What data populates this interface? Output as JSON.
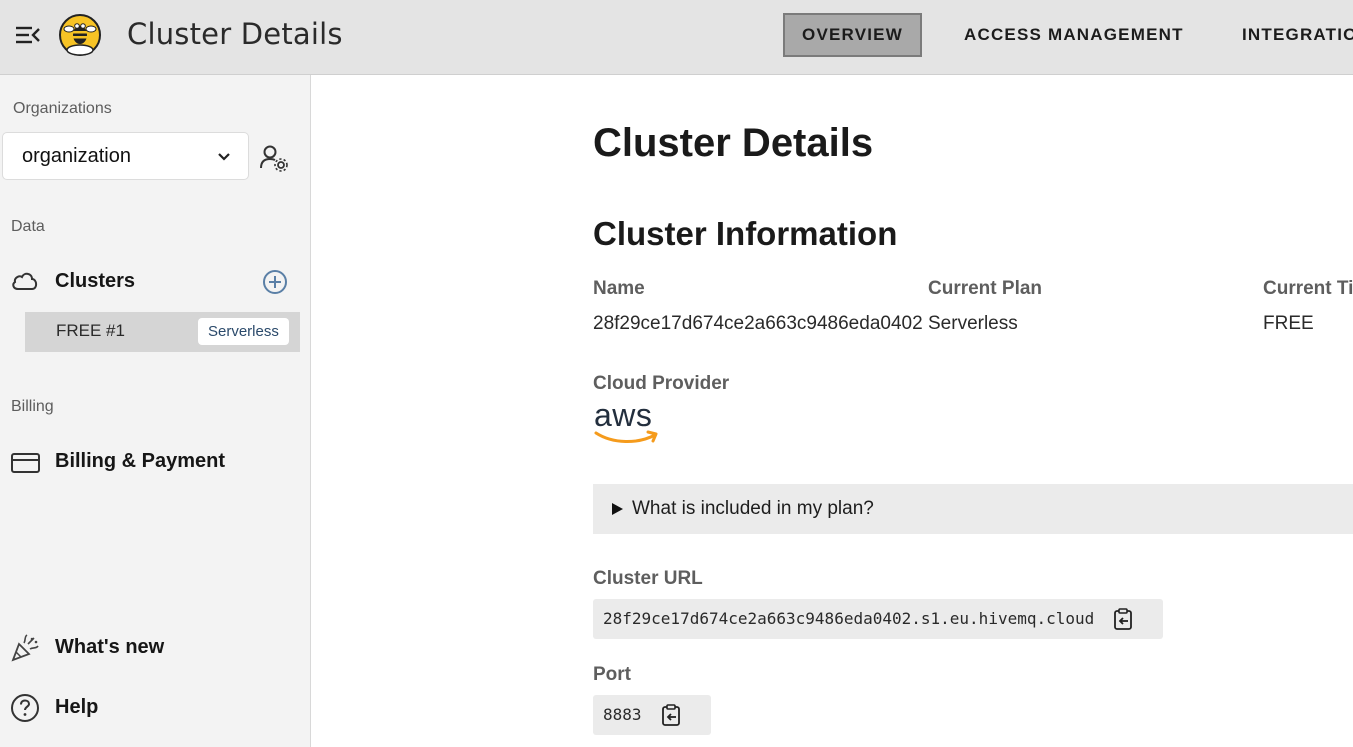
{
  "header": {
    "title": "Cluster Details",
    "tabs": [
      {
        "label": "OVERVIEW",
        "active": true
      },
      {
        "label": "ACCESS MANAGEMENT",
        "active": false
      },
      {
        "label": "INTEGRATIO",
        "active": false
      }
    ]
  },
  "sidebar": {
    "organizations_label": "Organizations",
    "org_select_value": "organization",
    "data_label": "Data",
    "clusters_label": "Clusters",
    "cluster_item": {
      "name": "FREE #1",
      "badge": "Serverless"
    },
    "billing_label": "Billing",
    "billing_item": "Billing & Payment",
    "whats_new": "What's new",
    "help": "Help"
  },
  "main": {
    "page_title": "Cluster Details",
    "section_title": "Cluster Information",
    "fields": {
      "name_label": "Name",
      "name_value": "28f29ce17d674ce2a663c9486eda0402",
      "plan_label": "Current Plan",
      "plan_value": "Serverless",
      "tier_label": "Current Ti",
      "tier_value": "FREE"
    },
    "cloud_provider_label": "Cloud Provider",
    "cloud_provider_logo": "aws",
    "accordion_text": "What is included in my plan?",
    "cluster_url_label": "Cluster URL",
    "cluster_url": "28f29ce17d674ce2a663c9486eda0402.s1.eu.hivemq.cloud",
    "port_label": "Port",
    "port": "8883"
  },
  "colors": {
    "header_bg": "#e4e4e4",
    "active_tab_bg": "#a9a9a9",
    "sidebar_bg": "#f3f3f3",
    "selected_cluster_bg": "#d5d5d5",
    "aws_orange": "#f59b1c",
    "aws_text": "#232f3e",
    "add_icon_blue": "#5a7fa6"
  }
}
